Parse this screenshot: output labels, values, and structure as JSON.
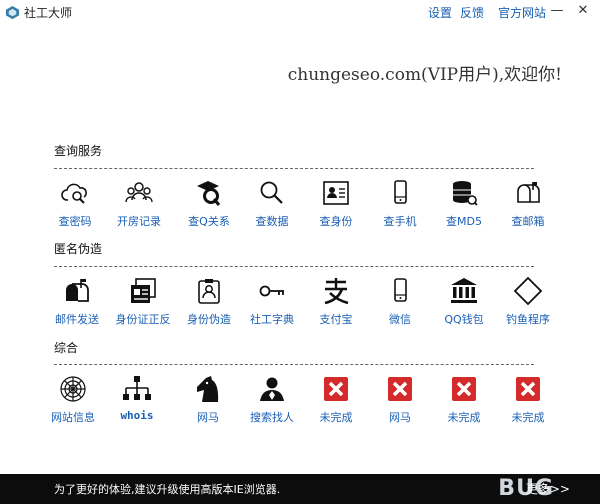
{
  "window": {
    "title": "社工大师",
    "links": [
      "设置",
      "反馈",
      "官方网站"
    ],
    "minimize_symbol": "—",
    "close_symbol": "✕"
  },
  "welcome": "chungeseo.com(VIP用户),欢迎你!",
  "sections": [
    {
      "title": "查询服务",
      "items": [
        {
          "label": "查密码",
          "icon": "cloud-search-icon"
        },
        {
          "label": "开房记录",
          "icon": "people-group-icon"
        },
        {
          "label": "查Q关系",
          "icon": "graduation-q-icon"
        },
        {
          "label": "查数据",
          "icon": "magnifier-icon"
        },
        {
          "label": "查身份",
          "icon": "id-card-icon"
        },
        {
          "label": "查手机",
          "icon": "mobile-phone-icon"
        },
        {
          "label": "查MD5",
          "icon": "database-icon"
        },
        {
          "label": "查邮箱",
          "icon": "mailbox-icon"
        }
      ]
    },
    {
      "title": "匿名伪造",
      "items": [
        {
          "label": "邮件发送",
          "icon": "mail-send-icon"
        },
        {
          "label": "身份证正反",
          "icon": "id-documents-icon"
        },
        {
          "label": "身份伪造",
          "icon": "badge-person-icon"
        },
        {
          "label": "社工字典",
          "icon": "key-icon"
        },
        {
          "label": "支付宝",
          "icon": "alipay-icon"
        },
        {
          "label": "微信",
          "icon": "mobile-phone-icon"
        },
        {
          "label": "QQ钱包",
          "icon": "bank-icon"
        },
        {
          "label": "钓鱼程序",
          "icon": "diamond-icon"
        }
      ]
    },
    {
      "title": "综合",
      "items": [
        {
          "label": "网站信息",
          "icon": "spider-web-icon"
        },
        {
          "label": "whois",
          "icon": "network-tree-icon"
        },
        {
          "label": "网马",
          "icon": "horse-head-icon"
        },
        {
          "label": "搜索找人",
          "icon": "person-search-icon"
        },
        {
          "label": "未完成",
          "icon": "red-x-icon"
        },
        {
          "label": "网马",
          "icon": "red-x-icon"
        },
        {
          "label": "未完成",
          "icon": "red-x-icon"
        },
        {
          "label": "未完成",
          "icon": "red-x-icon"
        }
      ]
    }
  ],
  "footer": {
    "text": "为了更好的体验,建议升级使用高版本IE浏览器.",
    "more": "更多>>"
  },
  "colors": {
    "link": "#1a5fb4",
    "footer_bg": "#0c0c0c",
    "unfinished_red": "#d42a2a"
  }
}
